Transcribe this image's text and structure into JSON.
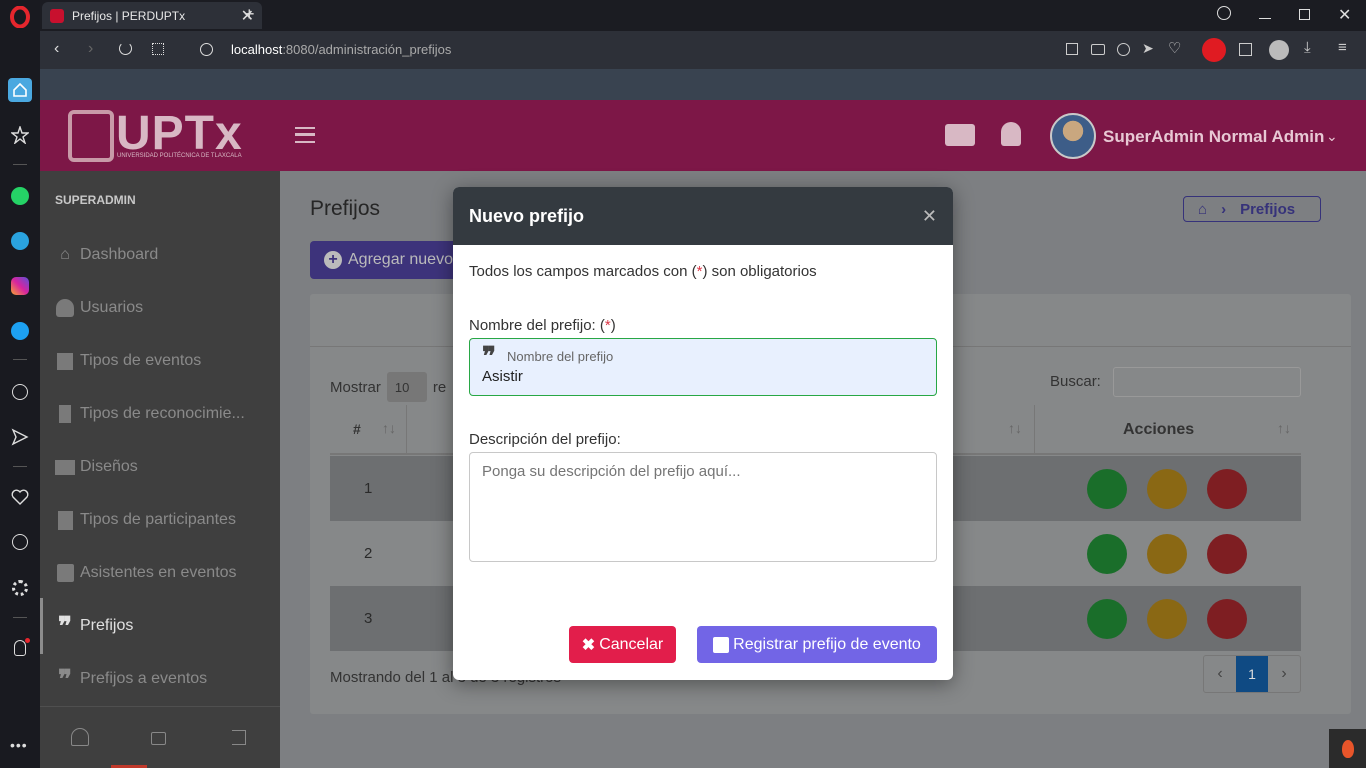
{
  "browser": {
    "tab_title": "Prefijos | PERDUPTx",
    "url_host": "localhost",
    "url_path": ":8080/administración_prefijos"
  },
  "header": {
    "logo_text": "UPTx",
    "logo_subtitle": "UNIVERSIDAD POLITÉCNICA DE TLAXCALA",
    "user_name": "SuperAdmin Normal Admin"
  },
  "sidebar": {
    "role": "SUPERADMIN",
    "items": [
      {
        "label": "Dashboard"
      },
      {
        "label": "Usuarios"
      },
      {
        "label": "Tipos de eventos"
      },
      {
        "label": "Tipos de reconocimie..."
      },
      {
        "label": "Diseños"
      },
      {
        "label": "Tipos de participantes"
      },
      {
        "label": "Asistentes en eventos"
      },
      {
        "label": "Prefijos"
      },
      {
        "label": "Prefijos a eventos"
      }
    ]
  },
  "page": {
    "title": "Prefijos",
    "breadcrumb": "Prefijos",
    "add_button": "Agregar nuevo",
    "show_label": "Mostrar",
    "show_value": "10",
    "show_suffix": "re",
    "search_label": "Buscar:",
    "col_num": "#",
    "col_actions": "Acciones",
    "rows": [
      "1",
      "2",
      "3"
    ],
    "footer_info": "Mostrando del 1 al 3 de 3 registros",
    "current_page": "1"
  },
  "modal": {
    "title": "Nuevo prefijo",
    "required_note_pre": "Todos los campos marcados con (",
    "required_star": "*",
    "required_note_post": ") son obligatorios",
    "name_label": "Nombre del prefijo: (",
    "name_star": "*",
    "name_label_end": ")",
    "name_float_label": "Nombre del prefijo",
    "name_value": "Asistir",
    "desc_label": "Descripción del prefijo:",
    "desc_placeholder": "Ponga su descripción del prefijo aquí...",
    "cancel_button": "Cancelar",
    "submit_button": "Registrar prefijo de evento"
  },
  "colors": {
    "brand": "#7d1747",
    "purple": "#6f42c1",
    "danger": "#dc3545",
    "success": "#28a745",
    "warning": "#e0a020"
  }
}
